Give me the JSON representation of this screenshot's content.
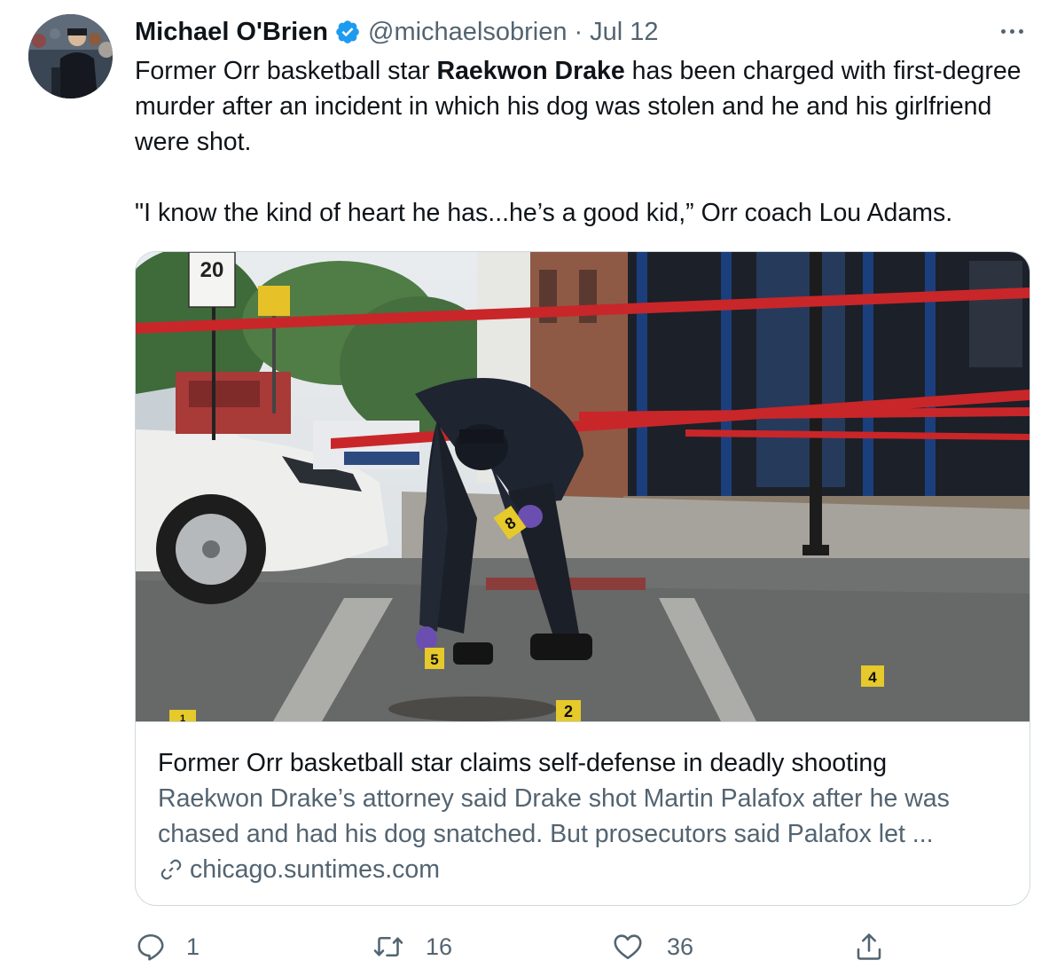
{
  "tweet": {
    "author_name": "Michael O'Brien",
    "handle": "@michaelsobrien",
    "separator": "·",
    "date": "Jul 12",
    "text_part1": "Former Orr basketball star ",
    "text_bold": "Raekwon Drake",
    "text_part2": " has been charged with first-degree murder after an incident in which his dog was stolen and he and his girlfriend were shot.",
    "quote": "\"I know the kind of heart he has...he’s a good kid,” Orr coach Lou Adams."
  },
  "card": {
    "title": "Former Orr basketball star claims self-defense in deadly shooting",
    "description": "Raekwon Drake’s attorney said Drake shot Martin Palafox after he was chased and had his dog snatched. But prosecutors said Palafox let ...",
    "domain": "chicago.suntimes.com",
    "image_text": {
      "speed_limit": "20",
      "marker_1": "1",
      "marker_2": "2",
      "marker_4": "4",
      "marker_5": "5",
      "marker_8": "8"
    }
  },
  "actions": {
    "reply_count": "1",
    "retweet_count": "16",
    "like_count": "36"
  },
  "colors": {
    "text_primary": "#0f1419",
    "text_secondary": "#536471",
    "verified_blue": "#1d9bf0",
    "border": "#cfd9de"
  },
  "icons": {
    "verified": "verified-badge-icon",
    "more": "more-icon",
    "link": "link-icon",
    "reply": "reply-icon",
    "retweet": "retweet-icon",
    "like": "heart-icon",
    "share": "share-icon"
  }
}
